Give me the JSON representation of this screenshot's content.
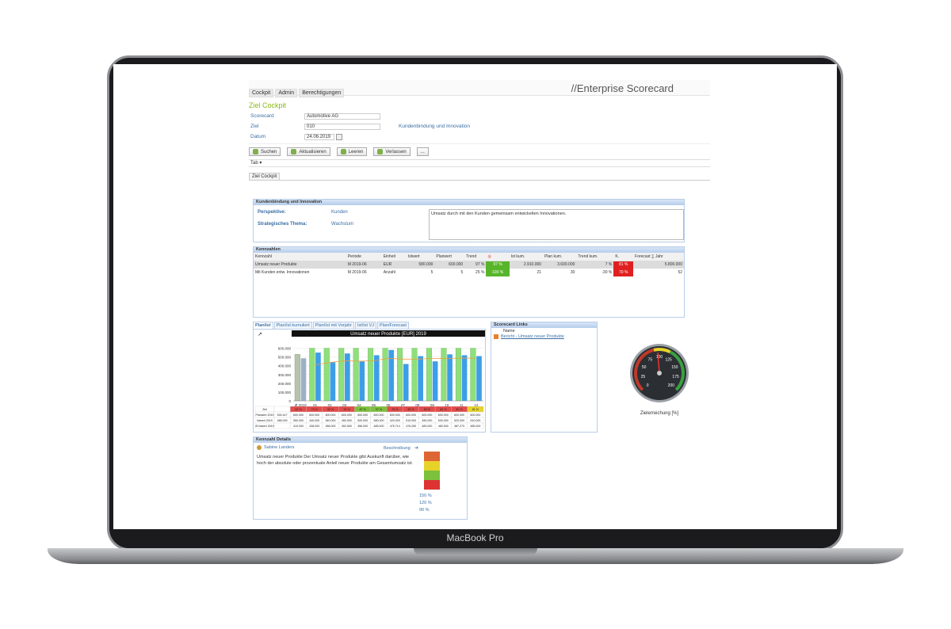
{
  "device": {
    "model_label": "MacBook Pro"
  },
  "app": {
    "brand": "//Enterprise Scorecard",
    "menu": [
      "Cockpit",
      "Admin",
      "Berechtigungen"
    ],
    "page_title": "Ziel Cockpit",
    "form": {
      "scorecard_label": "Scorecard",
      "scorecard_value": "Automotive AG",
      "ziel_label": "Ziel",
      "ziel_value": "010",
      "ziel_name": "Kundenbindung und Innovation",
      "datum_label": "Datum",
      "datum_value": "24.06.2019"
    },
    "buttons": {
      "suchen": "Suchen",
      "aktualisieren": "Aktualisieren",
      "leeren": "Leeren",
      "verlassen": "Verlassen",
      "more": "..."
    },
    "tab_menu": "Tab ▾",
    "subtab": "Ziel Cockpit",
    "goal_panel": {
      "title": "Kundenbindung und Innovation",
      "perspektive_label": "Perspektive:",
      "perspektive_value": "Kunden",
      "thema_label": "Strategisches Thema:",
      "thema_value": "Wachstum",
      "description": "Umsatz durch mit den Kunden gemeinsam entwickelten Innovationen."
    },
    "kpi_panel": {
      "title": "Kennzahlen",
      "columns": [
        "Kennzahl",
        "Periode",
        "Einheit",
        "Istwert",
        "Planwert",
        "Trend",
        "",
        "Ist kum.",
        "Plan kum.",
        "Trend kum.",
        "K.",
        "Forecast ∑ Jahr"
      ],
      "rows": [
        {
          "name": "Umsatz neuer Produkte",
          "periode": "M 2019-06",
          "einheit": "EUR",
          "ist": "580.000",
          "plan": "600.000",
          "trend": "97 %",
          "zg": "97 %",
          "ist_kum": "2.910.000",
          "plan_kum": "3.600.000",
          "trend_kum": "7 %",
          "zg_kum": "81 %",
          "forecast": "5.800.000"
        },
        {
          "name": "Mit Kunden entw. Innovationen",
          "periode": "M 2019-06",
          "einheit": "Anzahl",
          "ist": "5",
          "plan": "5",
          "trend": "25 %",
          "zg": "100 %",
          "ist_kum": "21",
          "plan_kum": "30",
          "trend_kum": "-30 %",
          "zg_kum": "70 %",
          "forecast": "52"
        }
      ]
    },
    "chart_tabs": [
      "Plan/Ist",
      "Plan/Ist kumuliert",
      "Plan/Ist mit Vorjahr",
      "Ist/Ist VJ",
      "Plan/Forecast"
    ],
    "chart_table": {
      "header": [
        "Ziel",
        "",
        "92 %",
        "73 %",
        "90 %",
        "76 %",
        "87 %",
        "97 %",
        "79 %",
        "80 %",
        "80 %",
        "80 %",
        "80 %",
        "81 %"
      ],
      "rows": [
        {
          "label": "Planwert 2019",
          "values": [
            "530.417",
            "600.000",
            "600.000",
            "600.000",
            "600.000",
            "600.000",
            "600.000",
            "600.000",
            "600.000",
            "600.000",
            "600.000",
            "600.000",
            "600.000"
          ]
        },
        {
          "label": "Istwert 2019",
          "values": [
            "485.000",
            "550.000",
            "440.000",
            "540.000",
            "450.000",
            "520.000",
            "580.000",
            "420.000",
            "510.000",
            "450.000",
            "530.000",
            "520.000",
            "510.000"
          ]
        },
        {
          "label": "Ø Istwert 2019",
          "values": [
            "",
            "410.000",
            "438.000",
            "456.000",
            "452.500",
            "456.000",
            "485.000",
            "475.714",
            "476.250",
            "483.000",
            "483.000",
            "487.273",
            "485.000"
          ]
        }
      ]
    },
    "links_panel": {
      "title": "Scorecard Links",
      "column": "Name",
      "link": "Bericht - Umsatz neuer Produkte"
    },
    "gauge": {
      "label": "Zielerreichung [%]",
      "value": 97,
      "ticks": [
        "0",
        "25",
        "50",
        "75",
        "100",
        "125",
        "150",
        "175",
        "200"
      ]
    },
    "detail_panel": {
      "title": "Kennzahl Details",
      "owner": "Sabine Landers",
      "desc_link": "Beschreibung",
      "text": "Umsatz neuer Produkte Der Umsatz neuer Produkte gibt Auskunft darüber, wie hoch der absolute oder prozentuale Anteil neuer Produkte am Gesamtumsatz ist.",
      "thresholds": [
        "150 %",
        "120 %",
        "90 %"
      ]
    }
  },
  "chart_data": {
    "type": "bar",
    "title": "Umsatz neuer Produkte [EUR] 2019",
    "categories": [
      "Ø 2019",
      "01",
      "02",
      "03",
      "04",
      "05",
      "06",
      "07",
      "08",
      "09",
      "10",
      "11",
      "12"
    ],
    "ylim": [
      0,
      650000
    ],
    "yticks": [
      "600.000",
      "500.000",
      "400.000",
      "300.000",
      "200.000",
      "100.000",
      "0"
    ],
    "series": [
      {
        "name": "Planwert 2019",
        "type": "bar",
        "color": "#8ee07a",
        "values": [
          530417,
          600000,
          600000,
          600000,
          600000,
          600000,
          600000,
          600000,
          600000,
          600000,
          600000,
          600000,
          600000
        ]
      },
      {
        "name": "Istwert 2019",
        "type": "bar",
        "color": "#3d9ee8",
        "values": [
          485000,
          550000,
          440000,
          540000,
          450000,
          520000,
          580000,
          420000,
          510000,
          450000,
          530000,
          520000,
          510000
        ]
      },
      {
        "name": "Ø Istwert 2019",
        "type": "line",
        "color": "#f29a3a",
        "values": [
          null,
          410000,
          438000,
          456000,
          452500,
          456000,
          485000,
          475714,
          476250,
          483000,
          483000,
          487273,
          485000
        ]
      }
    ]
  }
}
